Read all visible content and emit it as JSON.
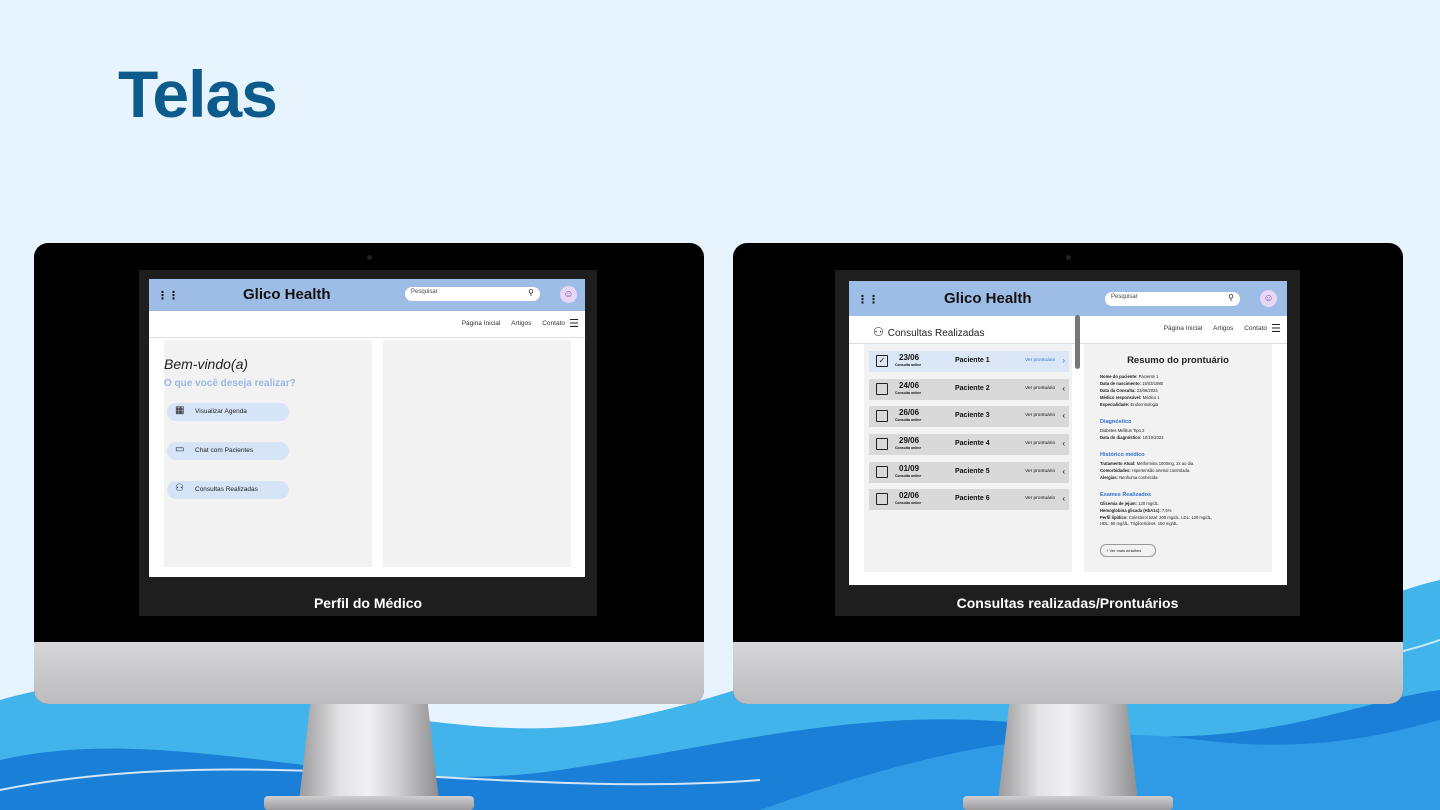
{
  "slide_title": "Telas",
  "left_screen": {
    "caption": "Perfil do Médico",
    "brand": "Glico Health",
    "search_placeholder": "Pesquisar",
    "nav": [
      "Página Inicial",
      "Artigos",
      "Contato"
    ],
    "welcome": "Bem-vindo(a)",
    "question": "O que você deseja realizar?",
    "actions": [
      {
        "label": "Visualizar Agenda",
        "icon": "calendar-icon"
      },
      {
        "label": "Chat com Pacientes",
        "icon": "chat-icon"
      },
      {
        "label": "Consultas Realizadas",
        "icon": "user-check-icon"
      }
    ]
  },
  "right_screen": {
    "caption": "Consultas realizadas/Prontuários",
    "brand": "Glico Health",
    "search_placeholder": "Pesquisar",
    "page_heading": "Consultas Realizadas",
    "nav": [
      "Página Inicial",
      "Artigos",
      "Contato"
    ],
    "consultations": [
      {
        "date": "23/06",
        "type": "Consulta online",
        "patient": "Paciente 1",
        "link": "Ver prontuário",
        "checked": true
      },
      {
        "date": "24/06",
        "type": "Consulta online",
        "patient": "Paciente 2",
        "link": "Ver prontuário",
        "checked": false
      },
      {
        "date": "26/06",
        "type": "Consulta online",
        "patient": "Paciente 3",
        "link": "Ver prontuário",
        "checked": false
      },
      {
        "date": "29/06",
        "type": "Consulta online",
        "patient": "Paciente 4",
        "link": "Ver prontuário",
        "checked": false
      },
      {
        "date": "01/09",
        "type": "Consulta online",
        "patient": "Paciente 5",
        "link": "Ver prontuário",
        "checked": false
      },
      {
        "date": "02/06",
        "type": "Consulta online",
        "patient": "Paciente 6",
        "link": "Ver prontuário",
        "checked": false
      }
    ],
    "summary": {
      "title": "Resumo do prontuário",
      "info": [
        {
          "k": "Nome do paciente:",
          "v": "Paciente 1"
        },
        {
          "k": "Data de nascimento:",
          "v": "15/03/1980"
        },
        {
          "k": "Data da Consulta:",
          "v": "23/06/2024"
        },
        {
          "k": "Médico responsável:",
          "v": "Médico 1"
        },
        {
          "k": "Especialidade:",
          "v": "Endocrinologia"
        }
      ],
      "diag_title": "Diagnóstico",
      "diag": [
        {
          "k": "",
          "v": "Diabetes Mellitus Tipo 2"
        },
        {
          "k": "Data do diagnóstico:",
          "v": "10/10/2022"
        }
      ],
      "hist_title": "Histórico médico",
      "hist": [
        {
          "k": "Tratamento Atual:",
          "v": "Metformina 1000mg, 2x ao dia."
        },
        {
          "k": "Comorbidades:",
          "v": "Hipertensão arterial controlada."
        },
        {
          "k": "Alergias:",
          "v": "Nenhuma conhecida."
        }
      ],
      "exam_title": "Exames Realizados",
      "exam": [
        {
          "k": "Glicemia de jejum:",
          "v": "120 mg/dL."
        },
        {
          "k": "Hemoglobina glicada (HbA1c):",
          "v": "7,5%"
        },
        {
          "k": "Perfil lipídico:",
          "v": "Colesterol total: 200 mg/dL, LDL: 120 mg/dL, HDL: 50 mg/dL, Triglicerídeos: 150 mg/dL."
        }
      ],
      "more_button": "+ Ver mais detalhes"
    }
  }
}
